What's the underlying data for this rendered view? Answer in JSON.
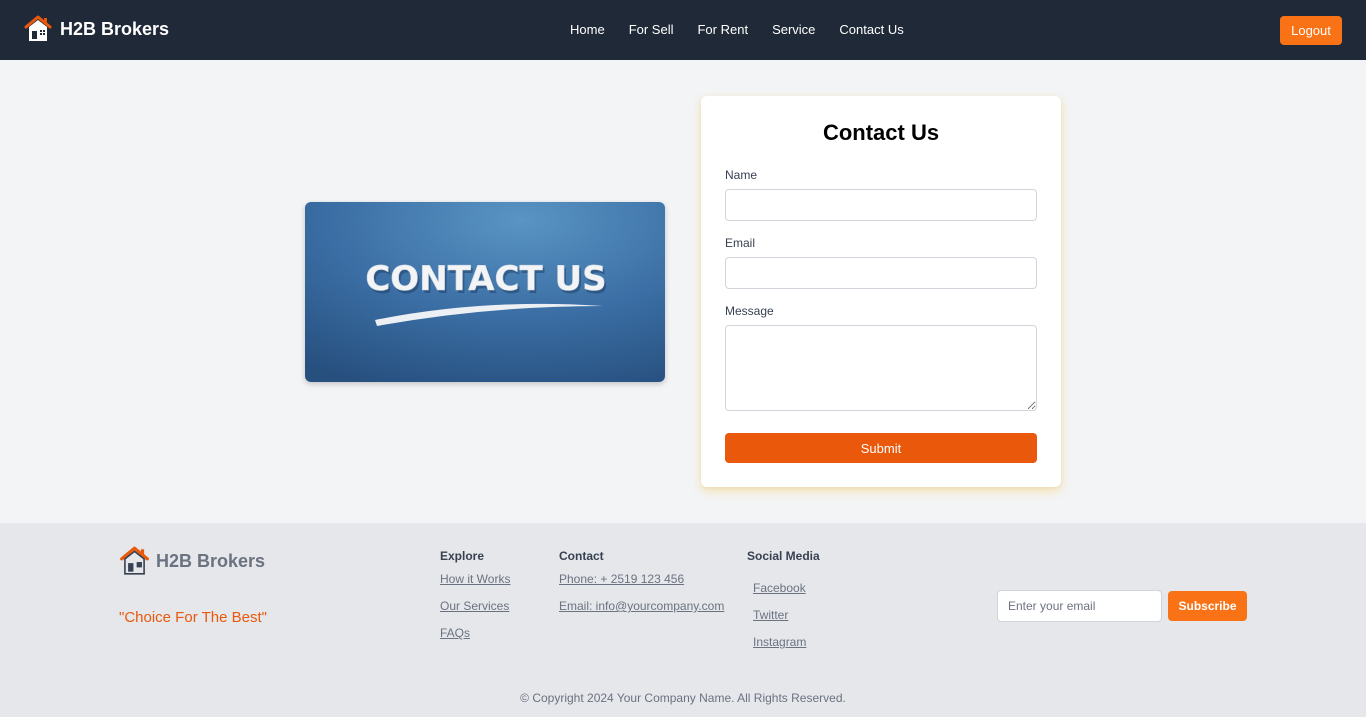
{
  "header": {
    "brand": "H2B Brokers",
    "nav": [
      "Home",
      "For Sell",
      "For Rent",
      "Service",
      "Contact Us"
    ],
    "logout_label": "Logout"
  },
  "hero": {
    "image_text": "CONTACT US"
  },
  "form": {
    "title": "Contact Us",
    "name_label": "Name",
    "email_label": "Email",
    "message_label": "Message",
    "submit_label": "Submit"
  },
  "footer": {
    "brand": "H2B Brokers",
    "tagline": "\"Choice For The Best\"",
    "explore": {
      "title": "Explore",
      "links": [
        "How it Works",
        "Our Services",
        "FAQs"
      ]
    },
    "contact": {
      "title": "Contact",
      "phone": "Phone: + 2519 123 456",
      "email": "Email: info@yourcompany.com"
    },
    "social": {
      "title": "Social Media",
      "links": [
        "Facebook",
        "Twitter",
        "Instagram"
      ]
    },
    "subscribe_placeholder": "Enter your email",
    "subscribe_label": "Subscribe",
    "copyright": "© Copyright 2024 Your Company Name. All Rights Reserved."
  },
  "colors": {
    "header_bg": "#1f2937",
    "accent": "#f97316",
    "submit": "#ea580c",
    "page_bg": "#f3f4f6",
    "footer_bg": "#e5e7eb"
  },
  "icons": {
    "brand": "house-icon"
  }
}
